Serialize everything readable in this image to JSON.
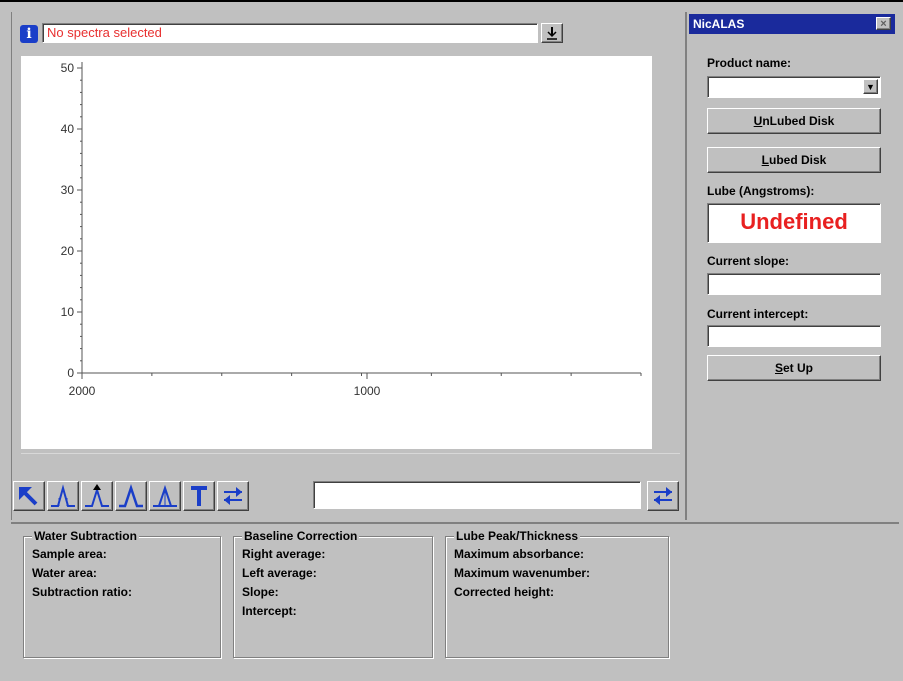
{
  "status": {
    "message": "No spectra selected"
  },
  "chart_data": {
    "type": "line",
    "x_ticks": [
      "2000",
      "1000"
    ],
    "y_ticks": [
      "50",
      "40",
      "30",
      "20",
      "10",
      "0"
    ],
    "ylim": [
      0,
      50
    ],
    "series": []
  },
  "results": {
    "water": {
      "title": "Water Subtraction",
      "fields": [
        "Sample area:",
        "Water area:",
        "Subtraction ratio:"
      ]
    },
    "baseline": {
      "title": "Baseline Correction",
      "fields": [
        "Right average:",
        "Left average:",
        "Slope:",
        "Intercept:"
      ]
    },
    "lube": {
      "title": "Lube Peak/Thickness",
      "fields": [
        "Maximum absorbance:",
        "Maximum wavenumber:",
        "Corrected height:"
      ]
    }
  },
  "side": {
    "title": "NicALAS",
    "close": "×",
    "product_label": "Product name:",
    "product_value": "",
    "unlubed_first": "U",
    "unlubed_rest": "nLubed Disk",
    "lubed_first": "L",
    "lubed_rest": "ubed Disk",
    "lube_label": "Lube (Angstroms):",
    "lube_value": "Undefined",
    "slope_label": "Current slope:",
    "slope_value": "",
    "intercept_label": "Current intercept:",
    "intercept_value": "",
    "setup_first": "S",
    "setup_rest": "et Up"
  },
  "colors": {
    "accent_blue": "#1a3ec8",
    "alert_red": "#e82020",
    "face": "#c0c0c0"
  },
  "icons": [
    "info-icon",
    "download-icon",
    "pointer-arrow-icon",
    "peak-icon",
    "peak-marker-icon",
    "peak-outline-icon",
    "peak-area-icon",
    "text-tool-icon",
    "swap-icon"
  ]
}
